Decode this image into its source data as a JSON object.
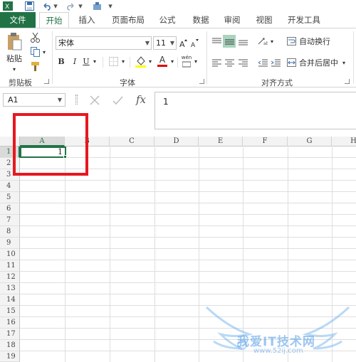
{
  "ribbon_tabs": {
    "file": "文件",
    "home": "开始",
    "insert": "插入",
    "page_layout": "页面布局",
    "formulas": "公式",
    "data": "数据",
    "review": "审阅",
    "view": "视图",
    "developer": "开发工具"
  },
  "clipboard": {
    "paste_label": "粘贴",
    "group_label": "剪贴板"
  },
  "font": {
    "font_name": "宋体",
    "font_size": "11",
    "bold": "B",
    "italic": "I",
    "underline": "U",
    "font_color_glyph": "A",
    "phonetic": "wén",
    "group_label": "字体"
  },
  "alignment": {
    "wrap_text_label": "自动换行",
    "merge_center_label": "合并后居中",
    "group_label": "对齐方式"
  },
  "formula_bar": {
    "name_box": "A1",
    "fx_label": "fx",
    "value": "1"
  },
  "sheet": {
    "columns": [
      "A",
      "B",
      "C",
      "D",
      "E",
      "F",
      "G",
      "H"
    ],
    "rows": [
      "1",
      "2",
      "3",
      "4",
      "5",
      "6",
      "7",
      "8",
      "9",
      "10",
      "11",
      "12",
      "13",
      "14",
      "15",
      "16",
      "17",
      "18",
      "19"
    ],
    "active_cell": "A1",
    "a1_value": "1"
  },
  "watermark": {
    "text": "我爱IT技术网",
    "url": "www.52ij.com"
  },
  "colors": {
    "accent": "#217346",
    "highlight": "#e8171f"
  }
}
